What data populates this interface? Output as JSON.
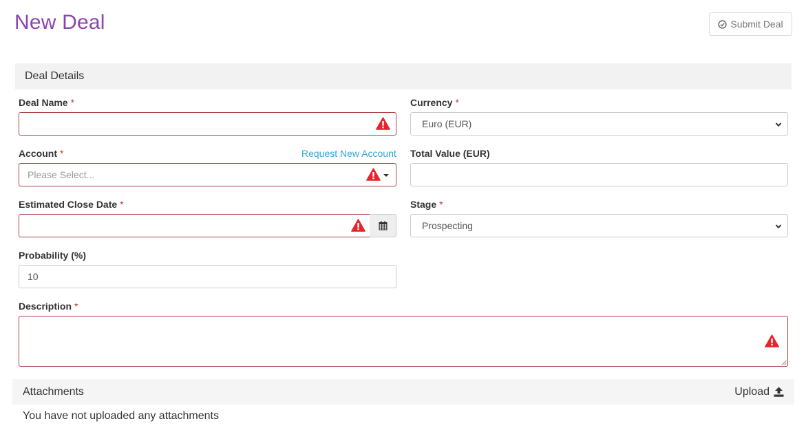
{
  "page": {
    "title": "New Deal"
  },
  "toolbar": {
    "submit_label": "Submit Deal"
  },
  "deal_details": {
    "section_title": "Deal Details",
    "required_marker": "*",
    "deal_name": {
      "label": "Deal Name",
      "value": ""
    },
    "currency": {
      "label": "Currency",
      "value": "Euro (EUR)"
    },
    "account": {
      "label": "Account",
      "placeholder": "Please Select...",
      "request_link": "Request New Account"
    },
    "total_value": {
      "label": "Total Value (EUR)",
      "value": ""
    },
    "close_date": {
      "label": "Estimated Close Date",
      "value": ""
    },
    "stage": {
      "label": "Stage",
      "value": "Prospecting"
    },
    "probability": {
      "label": "Probability (%)",
      "value": "10"
    },
    "description": {
      "label": "Description",
      "value": ""
    }
  },
  "attachments": {
    "title": "Attachments",
    "upload_label": "Upload",
    "empty_message": "You have not uploaded any attachments"
  },
  "colors": {
    "title": "#8e44ad",
    "error": "#a94442",
    "warning_icon": "#e8232b",
    "link": "#2ea7d3"
  }
}
